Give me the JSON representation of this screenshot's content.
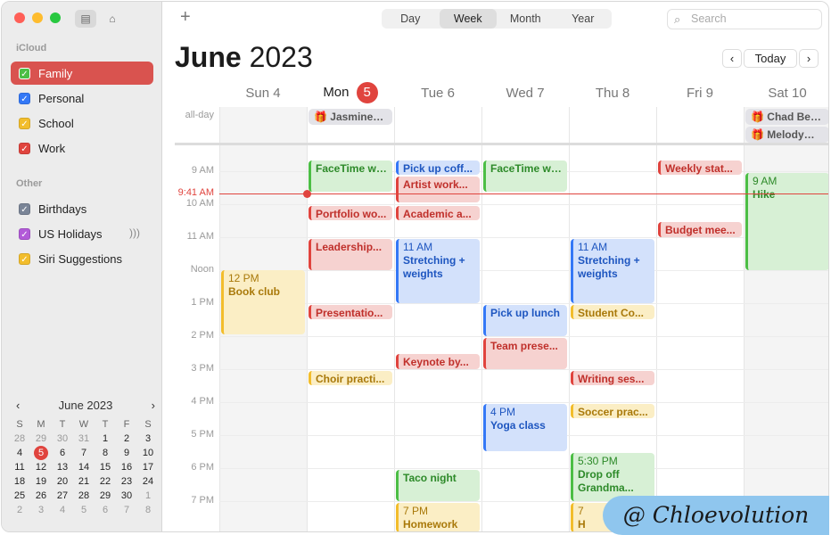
{
  "sidebar": {
    "icloud_heading": "iCloud",
    "other_heading": "Other",
    "icloud_calendars": [
      {
        "label": "Family",
        "color": "#4cbe45",
        "selected": true
      },
      {
        "label": "Personal",
        "color": "#3478f6"
      },
      {
        "label": "School",
        "color": "#f2bd2c"
      },
      {
        "label": "Work",
        "color": "#e0443e"
      }
    ],
    "other_calendars": [
      {
        "label": "Birthdays",
        "color": "#7a8597"
      },
      {
        "label": "US Holidays",
        "color": "#b25ad8"
      },
      {
        "label": "Siri Suggestions",
        "color": "#f2bd2c"
      }
    ],
    "mini_calendar": {
      "title": "June 2023",
      "weekdays": [
        "S",
        "M",
        "T",
        "W",
        "T",
        "F",
        "S"
      ],
      "weeks": [
        [
          "28",
          "29",
          "30",
          "31",
          "1",
          "2",
          "3"
        ],
        [
          "4",
          "5",
          "6",
          "7",
          "8",
          "9",
          "10"
        ],
        [
          "11",
          "12",
          "13",
          "14",
          "15",
          "16",
          "17"
        ],
        [
          "18",
          "19",
          "20",
          "21",
          "22",
          "23",
          "24"
        ],
        [
          "25",
          "26",
          "27",
          "28",
          "29",
          "30",
          "1"
        ],
        [
          "2",
          "3",
          "4",
          "5",
          "6",
          "7",
          "8"
        ]
      ],
      "today": "5"
    }
  },
  "toolbar": {
    "add_icon": "plus-icon",
    "views": [
      "Day",
      "Week",
      "Month",
      "Year"
    ],
    "active_view": "Week",
    "search_placeholder": "Search",
    "today_button": "Today"
  },
  "header": {
    "month": "June",
    "year": "2023"
  },
  "days": [
    {
      "name": "Sun",
      "num": "4"
    },
    {
      "name": "Mon",
      "num": "5",
      "today": true
    },
    {
      "name": "Tue",
      "num": "6"
    },
    {
      "name": "Wed",
      "num": "7"
    },
    {
      "name": "Thu",
      "num": "8"
    },
    {
      "name": "Fri",
      "num": "9"
    },
    {
      "name": "Sat",
      "num": "10"
    }
  ],
  "allday_label": "all-day",
  "allday_events": [
    {
      "day": 1,
      "row": 0,
      "title": "Jasmine…"
    },
    {
      "day": 6,
      "row": 0,
      "title": "Chad Be…"
    },
    {
      "day": 6,
      "row": 1,
      "title": "Melody…"
    }
  ],
  "hours": [
    "9 AM",
    "10 AM",
    "11 AM",
    "Noon",
    "1 PM",
    "2 PM",
    "3 PM",
    "4 PM",
    "5 PM",
    "6 PM",
    "7 PM"
  ],
  "current_time": "9:41 AM",
  "events": [
    {
      "day": 0,
      "start": 12.0,
      "end": 14.0,
      "color": "yellow",
      "time": "12 PM",
      "title": "Book club"
    },
    {
      "day": 1,
      "start": 8.67,
      "end": 9.67,
      "color": "green",
      "title": "FaceTime wi..."
    },
    {
      "day": 1,
      "start": 10.05,
      "end": 10.55,
      "color": "red",
      "title": "Portfolio wo..."
    },
    {
      "day": 1,
      "start": 11.05,
      "end": 12.05,
      "color": "red",
      "title": "Leadership..."
    },
    {
      "day": 1,
      "start": 13.05,
      "end": 13.55,
      "color": "red",
      "title": "Presentatio..."
    },
    {
      "day": 1,
      "start": 15.05,
      "end": 15.55,
      "color": "yellow",
      "title": "Choir practi..."
    },
    {
      "day": 2,
      "start": 8.67,
      "end": 9.17,
      "color": "blue",
      "title": "Pick up coff..."
    },
    {
      "day": 2,
      "start": 9.17,
      "end": 10.0,
      "color": "red",
      "title": "Artist work..."
    },
    {
      "day": 2,
      "start": 10.05,
      "end": 10.55,
      "color": "red",
      "title": "Academic a..."
    },
    {
      "day": 2,
      "start": 11.05,
      "end": 13.05,
      "color": "blue",
      "time": "11 AM",
      "title": "Stretching + weights"
    },
    {
      "day": 2,
      "start": 14.55,
      "end": 15.05,
      "color": "red",
      "title": "Keynote by..."
    },
    {
      "day": 2,
      "start": 18.05,
      "end": 19.05,
      "color": "green",
      "title": "Taco night"
    },
    {
      "day": 2,
      "start": 19.05,
      "end": 20.0,
      "color": "yellow",
      "time": "7 PM",
      "title": "Homework"
    },
    {
      "day": 3,
      "start": 8.67,
      "end": 9.67,
      "color": "green",
      "title": "FaceTime wi..."
    },
    {
      "day": 3,
      "start": 13.05,
      "end": 14.05,
      "color": "blue",
      "title": "Pick up lunch"
    },
    {
      "day": 3,
      "start": 14.05,
      "end": 15.05,
      "color": "red",
      "title": "Team prese..."
    },
    {
      "day": 3,
      "start": 16.05,
      "end": 17.55,
      "color": "blue",
      "time": "4 PM",
      "title": "Yoga class"
    },
    {
      "day": 4,
      "start": 11.05,
      "end": 13.05,
      "color": "blue",
      "time": "11 AM",
      "title": "Stretching + weights"
    },
    {
      "day": 4,
      "start": 13.05,
      "end": 13.55,
      "color": "yellow",
      "title": "Student Co..."
    },
    {
      "day": 4,
      "start": 15.05,
      "end": 15.55,
      "color": "red",
      "title": "Writing ses..."
    },
    {
      "day": 4,
      "start": 16.05,
      "end": 16.55,
      "color": "yellow",
      "title": "Soccer prac..."
    },
    {
      "day": 4,
      "start": 17.55,
      "end": 19.05,
      "color": "green",
      "time": "5:30 PM",
      "title": "Drop off Grandma..."
    },
    {
      "day": 4,
      "start": 19.05,
      "end": 20.0,
      "color": "yellow",
      "time": "7",
      "title": "H"
    },
    {
      "day": 5,
      "start": 8.67,
      "end": 9.17,
      "color": "red",
      "title": "Weekly stat..."
    },
    {
      "day": 5,
      "start": 10.55,
      "end": 11.05,
      "color": "red",
      "title": "Budget mee..."
    },
    {
      "day": 6,
      "start": 9.05,
      "end": 12.05,
      "color": "green",
      "time": "9 AM",
      "title": "Hike"
    }
  ],
  "watermark": "@ Chloevolution"
}
